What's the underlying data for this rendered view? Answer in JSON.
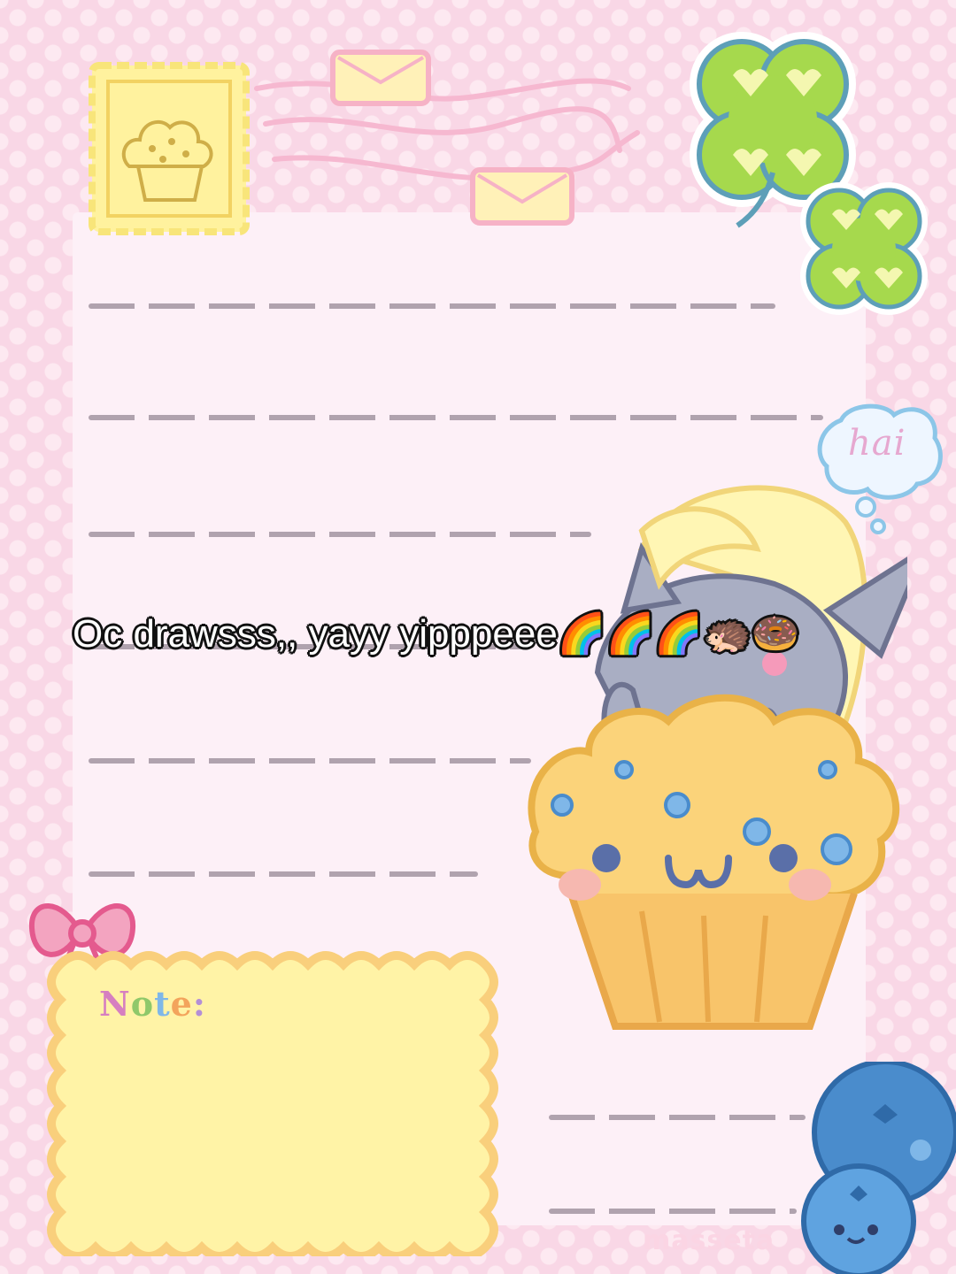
{
  "caption": {
    "text": "Oc drawsss,, yayy yipppeee🌈🌈🌈🦔🍩"
  },
  "speech_bubble": {
    "text": "hai"
  },
  "note": {
    "label": "Note:"
  },
  "watermark": {
    "text": "masseta"
  },
  "colors": {
    "background": "#f9d7e6",
    "paper": "#fdf0f7",
    "note_box": "#fff3a6",
    "note_border": "#f9cf7c",
    "clover": "#a6d94d",
    "muffin_top": "#fbd37a",
    "muffin_cup": "#f8c46a",
    "blueberry": "#4a8ccc"
  },
  "icons": [
    "muffin-stamp-icon",
    "envelope-icon",
    "four-leaf-clover-icon",
    "speech-bubble-icon",
    "pony-character-art",
    "muffin-icon",
    "ribbon-bow-icon",
    "blueberry-icon"
  ]
}
